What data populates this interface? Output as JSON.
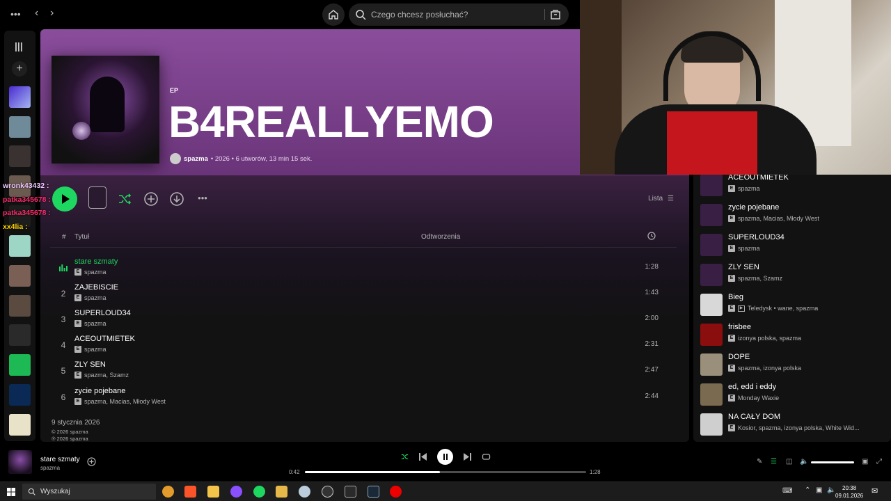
{
  "topbar": {
    "search_placeholder": "Czego chcesz posłuchać?"
  },
  "album": {
    "type": "EP",
    "title": "B4REALLYEMO",
    "artist": "spazma",
    "meta": "• 2026 • 6 utworów, 13 min 15 sek.",
    "view_mode": "Lista",
    "release_date": "9 stycznia 2026",
    "copyright_c": "© 2026 spazma",
    "copyright_p": "℗ 2026 spazma"
  },
  "table": {
    "col_num": "#",
    "col_title": "Tytuł",
    "col_plays": "Odtworzenia"
  },
  "tracks": [
    {
      "num": "",
      "title": "stare szmaty",
      "artists": "spazma",
      "duration": "1:28"
    },
    {
      "num": "2",
      "title": "ZAJEBISCIE",
      "artists": "spazma",
      "duration": "1:43"
    },
    {
      "num": "3",
      "title": "SUPERLOUD34",
      "artists": "spazma",
      "duration": "2:00"
    },
    {
      "num": "4",
      "title": "ACEOUTMIETEK",
      "artists": "spazma",
      "duration": "2:31"
    },
    {
      "num": "5",
      "title": "ZLY SEN",
      "artists": "spazma, Szamz",
      "duration": "2:47"
    },
    {
      "num": "6",
      "title": "zycie pojebane",
      "artists": "spazma, Macias, Młody West",
      "duration": "2:44"
    }
  ],
  "chat": [
    {
      "user": "wronk43432 :",
      "color": "#f0c8ff"
    },
    {
      "user": "patka345678 :",
      "color": "#ff2a6d"
    },
    {
      "user": "patka345678 :",
      "color": "#ff2a6d"
    },
    {
      "user": "xx4lia :",
      "color": "#ffd400"
    }
  ],
  "queue": [
    {
      "title": "ACEOUTMIETEK",
      "sub": "spazma",
      "video": false,
      "color": "#3a1f45"
    },
    {
      "title": "zycie pojebane",
      "sub": "spazma, Macias, Młody West",
      "video": false,
      "color": "#3a1f45"
    },
    {
      "title": "SUPERLOUD34",
      "sub": "spazma",
      "video": false,
      "color": "#3a1f45"
    },
    {
      "title": "ZLY SEN",
      "sub": "spazma, Szamz",
      "video": false,
      "color": "#3a1f45"
    },
    {
      "title": "Bieg",
      "sub": "Teledysk • wane, spazma",
      "video": true,
      "color": "#d8d8d8"
    },
    {
      "title": "frisbee",
      "sub": "izonya polska, spazma",
      "video": false,
      "color": "#8b0e0e"
    },
    {
      "title": "DOPE",
      "sub": "spazma, izonya polska",
      "video": false,
      "color": "#9a8f7a"
    },
    {
      "title": "ed, edd i eddy",
      "sub": "Monday Waxie",
      "video": false,
      "color": "#7a6a4f"
    },
    {
      "title": "NA CAŁY DOM",
      "sub": "Kosior, spazma, izonya polska, White Wid...",
      "video": false,
      "color": "#cfcfcf"
    }
  ],
  "player": {
    "title": "stare szmaty",
    "artist": "spazma",
    "current": "0:42",
    "total": "1:28",
    "progress": 0.48,
    "volume": 1.0
  },
  "taskbar": {
    "search_placeholder": "Wyszukaj",
    "time": "20:38",
    "date": "09.01.2026"
  },
  "colors": {
    "accent": "#1ed760",
    "hero": "#8a4d9c"
  }
}
